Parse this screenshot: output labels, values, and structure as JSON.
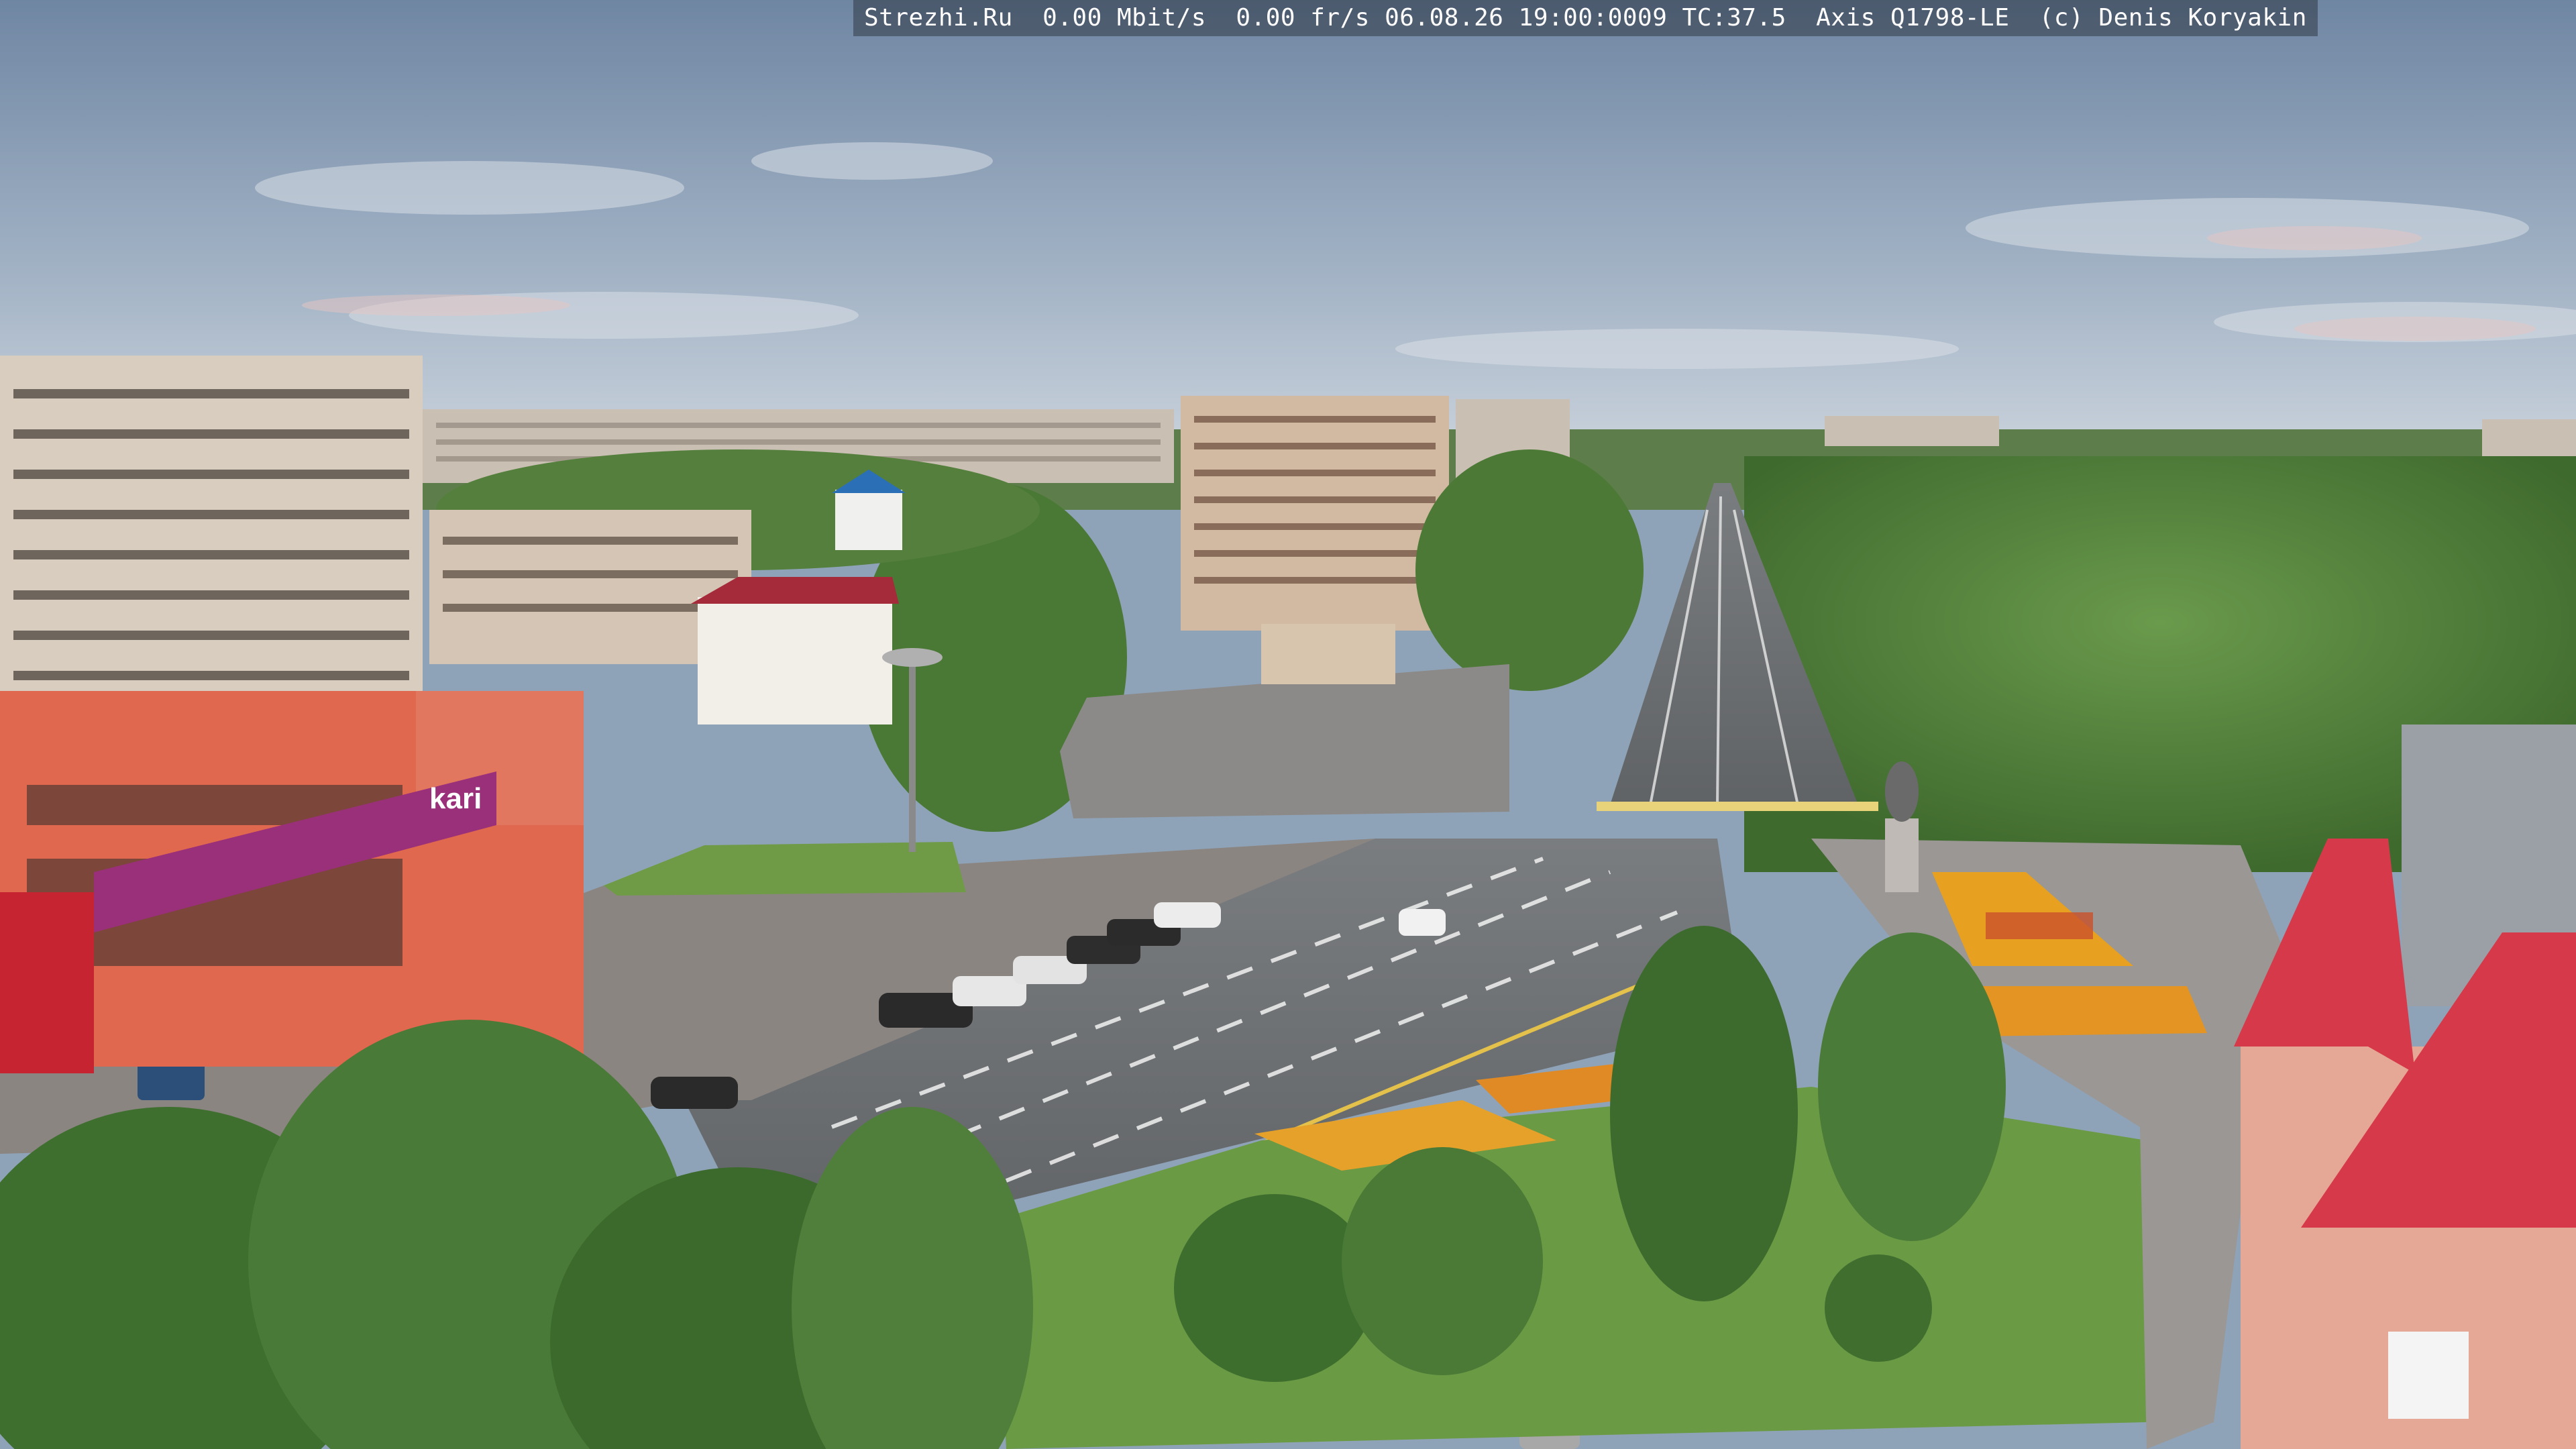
{
  "overlay": {
    "text": "Strezhi.Ru  0.00 Mbit/s  0.00 fr/s 06.08.26 19:00:0009 TC:37.5  Axis Q1798-LE  (c) Denis Koryakin"
  },
  "signs": {
    "store_brand": "kari"
  },
  "colors": {
    "sky_top": "#7f93ad",
    "sky_bottom": "#c9d3de",
    "road": "#6f7275",
    "plaza": "#8a8785",
    "grass": "#6b9a45",
    "trees": "#4f7f3a",
    "panel_building": "#d8cdbf",
    "store_facade": "#e0684e",
    "store_banner": "#9a2f7a",
    "roof_red": "#d63a4a",
    "flowers": "#e8a020"
  }
}
